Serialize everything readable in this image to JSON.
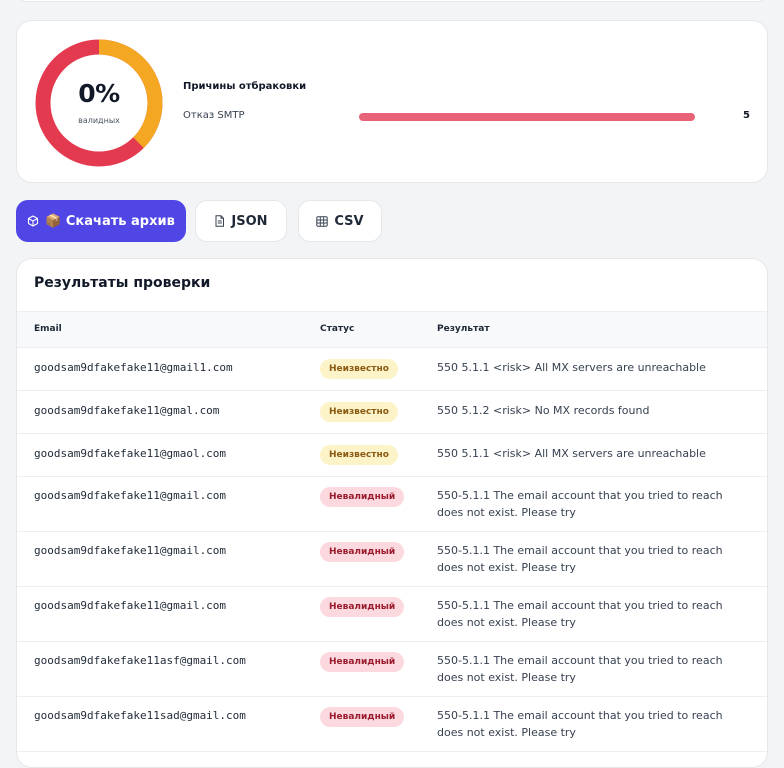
{
  "stats": {
    "percent": "0%",
    "percent_label": "валидных",
    "donut_colors": {
      "invalid": "#e43a4f",
      "unknown": "#f3a722"
    },
    "donut_fraction_unknown": 0.375,
    "reasons_title": "Причины отбраковки",
    "reasons": [
      {
        "label": "Отказ SMTP",
        "count": "5",
        "fraction": 1.0,
        "color": "#e96378"
      }
    ]
  },
  "actions": {
    "download_archive": "📦 Скачать архив",
    "json": "JSON",
    "csv": "CSV"
  },
  "results": {
    "title": "Результаты проверки",
    "columns": {
      "email": "Email",
      "status": "Статус",
      "result": "Результат"
    },
    "rows": [
      {
        "email": "goodsam9dfakefake11@gmail1.com",
        "status": "Неизвестно",
        "status_kind": "unknown",
        "result": "550 5.1.1 <risk> All MX servers are unreachable"
      },
      {
        "email": "goodsam9dfakefake11@gmal.com",
        "status": "Неизвестно",
        "status_kind": "unknown",
        "result": "550 5.1.2 <risk> No MX records found"
      },
      {
        "email": "goodsam9dfakefake11@gmaol.com",
        "status": "Неизвестно",
        "status_kind": "unknown",
        "result": "550 5.1.1 <risk> All MX servers are unreachable"
      },
      {
        "email": "goodsam9dfakefake11@gmail.com",
        "status": "Невалидный",
        "status_kind": "invalid",
        "result": "550-5.1.1 The email account that you tried to reach does not exist. Please try"
      },
      {
        "email": "goodsam9dfakefake11@gmail.com",
        "status": "Невалидный",
        "status_kind": "invalid",
        "result": "550-5.1.1 The email account that you tried to reach does not exist. Please try"
      },
      {
        "email": "goodsam9dfakefake11@gmail.com",
        "status": "Невалидный",
        "status_kind": "invalid",
        "result": "550-5.1.1 The email account that you tried to reach does not exist. Please try"
      },
      {
        "email": "goodsam9dfakefake11asf@gmail.com",
        "status": "Невалидный",
        "status_kind": "invalid",
        "result": "550-5.1.1 The email account that you tried to reach does not exist. Please try"
      },
      {
        "email": "goodsam9dfakefake11sad@gmail.com",
        "status": "Невалидный",
        "status_kind": "invalid",
        "result": "550-5.1.1 The email account that you tried to reach does not exist. Please try"
      }
    ]
  }
}
